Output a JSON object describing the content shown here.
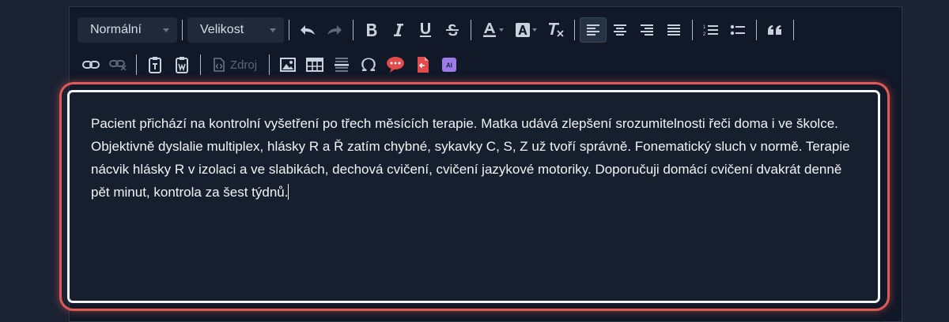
{
  "toolbar": {
    "format_dropdown": "Normální",
    "size_dropdown": "Velikost",
    "source_label": "Zdroj",
    "ai_label": "AI"
  },
  "editor": {
    "text": "Pacient přichází na kontrolní vyšetření po třech měsících terapie. Matka udává zlepšení srozumitelnosti řeči doma i ve školce. Objektivně dyslalie multiplex, hlásky R a Ř zatím chybné, sykavky C, S, Z už tvoří správně. Fonematický sluch v normě. Terapie nácvik hlásky R v izolaci a ve slabikách, dechová cvičení, cvičení jazykové motoriky. Doporučuji domácí cvičení dvakrát denně pět minut, kontrola za šest týdnů."
  },
  "colors": {
    "background": "#1b2333",
    "editor_background": "#161f2e",
    "highlight": "#e05a55",
    "comment_icon": "#e14b4b",
    "ai_badge": "#9f7aea"
  }
}
